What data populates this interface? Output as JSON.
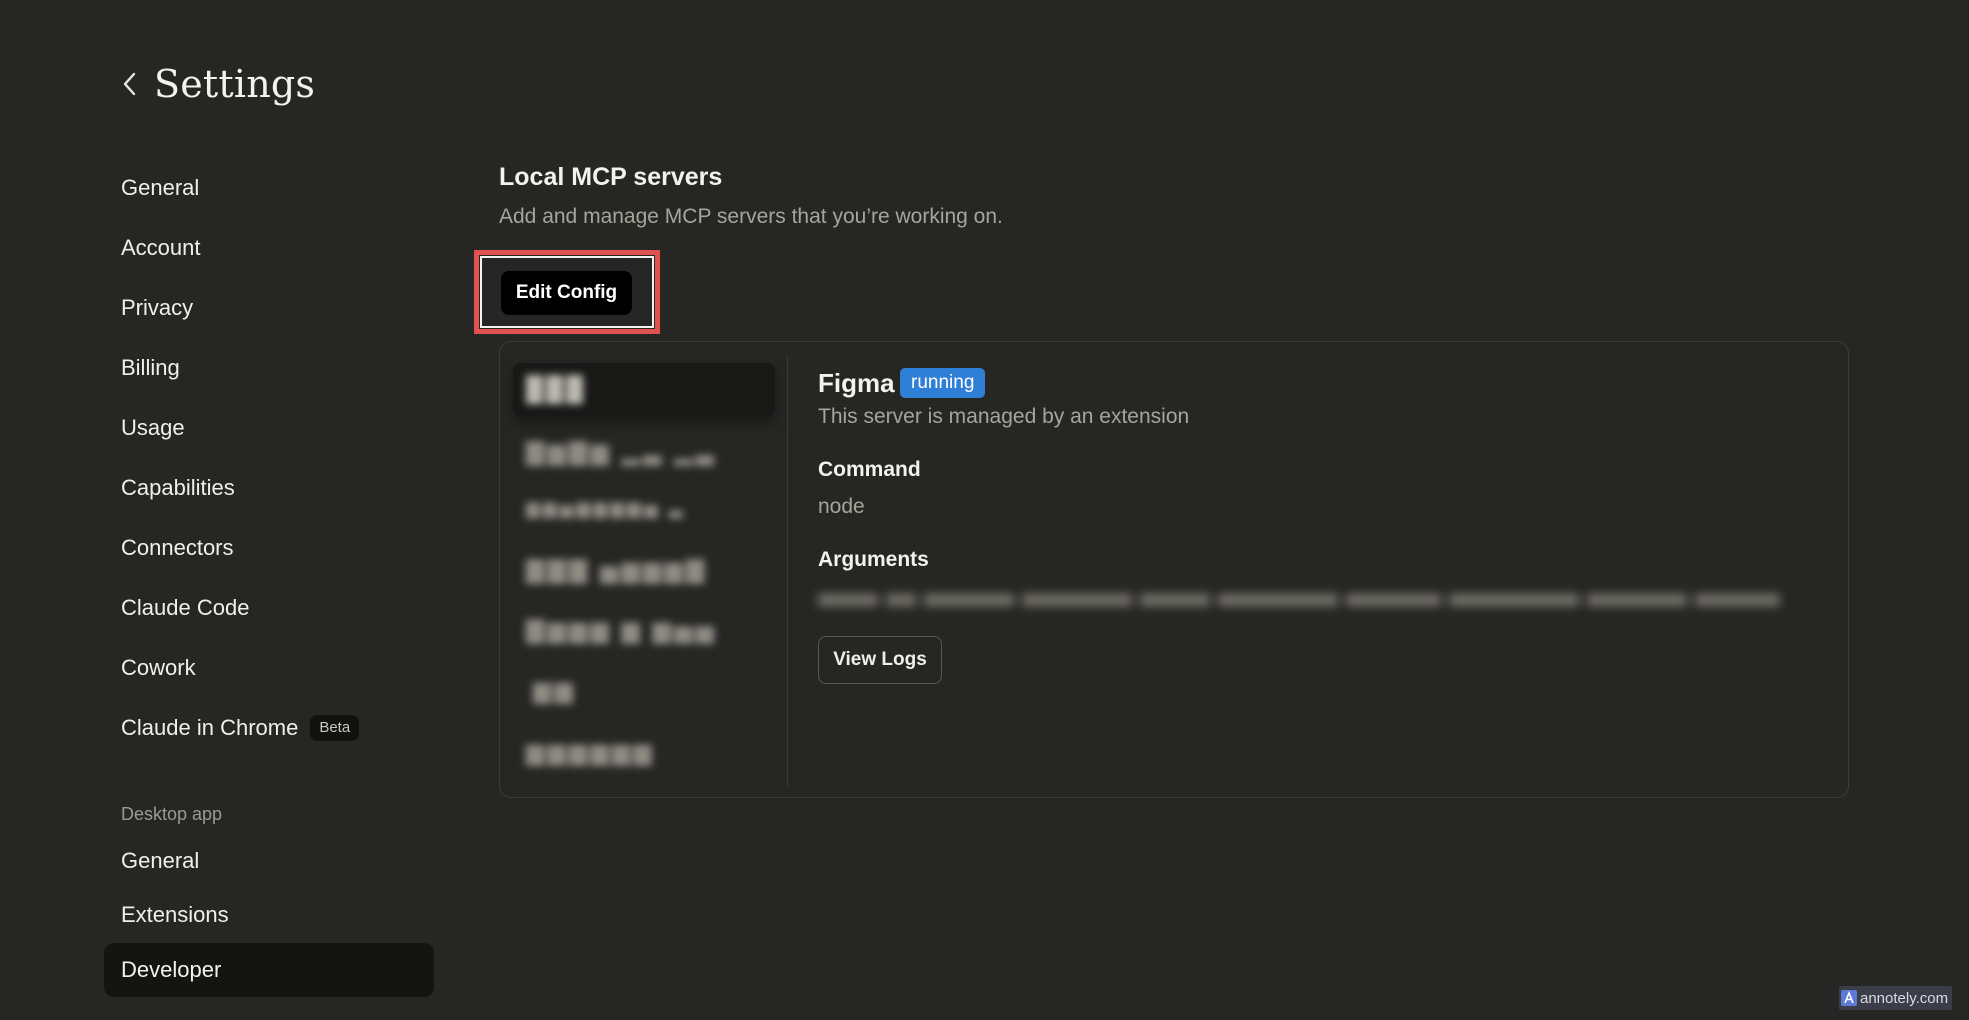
{
  "header": {
    "title": "Settings",
    "back_icon": "chevron-left-icon"
  },
  "sidebar": {
    "items": [
      {
        "label": "General"
      },
      {
        "label": "Account"
      },
      {
        "label": "Privacy"
      },
      {
        "label": "Billing"
      },
      {
        "label": "Usage"
      },
      {
        "label": "Capabilities"
      },
      {
        "label": "Connectors"
      },
      {
        "label": "Claude Code"
      },
      {
        "label": "Cowork"
      },
      {
        "label": "Claude in Chrome",
        "badge": "Beta"
      }
    ],
    "desktop_section_label": "Desktop app",
    "desktop_items": [
      {
        "label": "General"
      },
      {
        "label": "Extensions"
      },
      {
        "label": "Developer",
        "active": true
      }
    ]
  },
  "main": {
    "title": "Local MCP servers",
    "subtitle": "Add and manage MCP servers that you’re working on.",
    "edit_config_label": "Edit Config",
    "server": {
      "name": "Figma",
      "status": "running",
      "description": "This server is managed by an extension",
      "command_label": "Command",
      "command_value": "node",
      "arguments_label": "Arguments",
      "view_logs_label": "View Logs"
    }
  },
  "colors": {
    "background": "#262624",
    "highlight_border": "#e0524f",
    "status_badge": "#2f7fd6",
    "active_nav": "#141413"
  },
  "watermark": {
    "text": "annotely.com"
  }
}
